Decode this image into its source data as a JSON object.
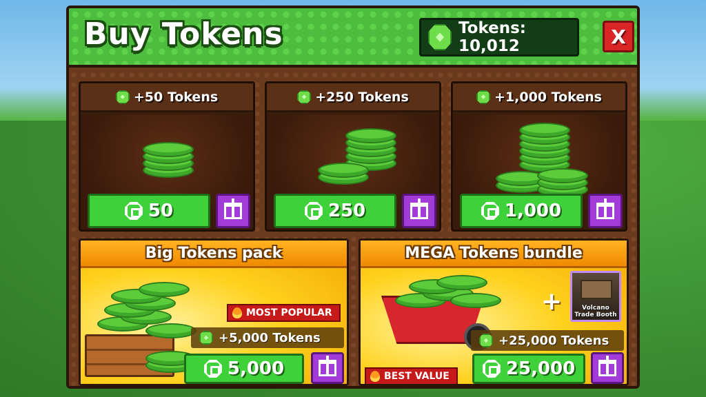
{
  "header": {
    "title": "Buy Tokens",
    "balance_label": "Tokens: 10,012",
    "close_label": "X"
  },
  "packs": [
    {
      "label": "+50 Tokens",
      "price": "50"
    },
    {
      "label": "+250 Tokens",
      "price": "250"
    },
    {
      "label": "+1,000 Tokens",
      "price": "1,000"
    }
  ],
  "big_pack": {
    "title": "Big Tokens pack",
    "badge": "MOST POPULAR",
    "amount": "+5,000 Tokens",
    "price": "5,000"
  },
  "mega_bundle": {
    "title": "MEGA Tokens bundle",
    "plus": "+",
    "bonus_item": "Volcano Trade Booth",
    "badge": "BEST VALUE",
    "amount": "+25,000 Tokens",
    "price": "25,000"
  },
  "colors": {
    "header_green": "#4dbd3d",
    "panel_brown": "#6b3a1c",
    "buy_green": "#3fd13a",
    "gift_purple": "#a33bd8",
    "close_red": "#d92525",
    "gold": "#ffd21f"
  },
  "icons": {
    "token": "token-gem-icon",
    "currency": "robux-icon",
    "gift": "gift-icon",
    "close": "close-icon",
    "fire": "fire-icon"
  }
}
